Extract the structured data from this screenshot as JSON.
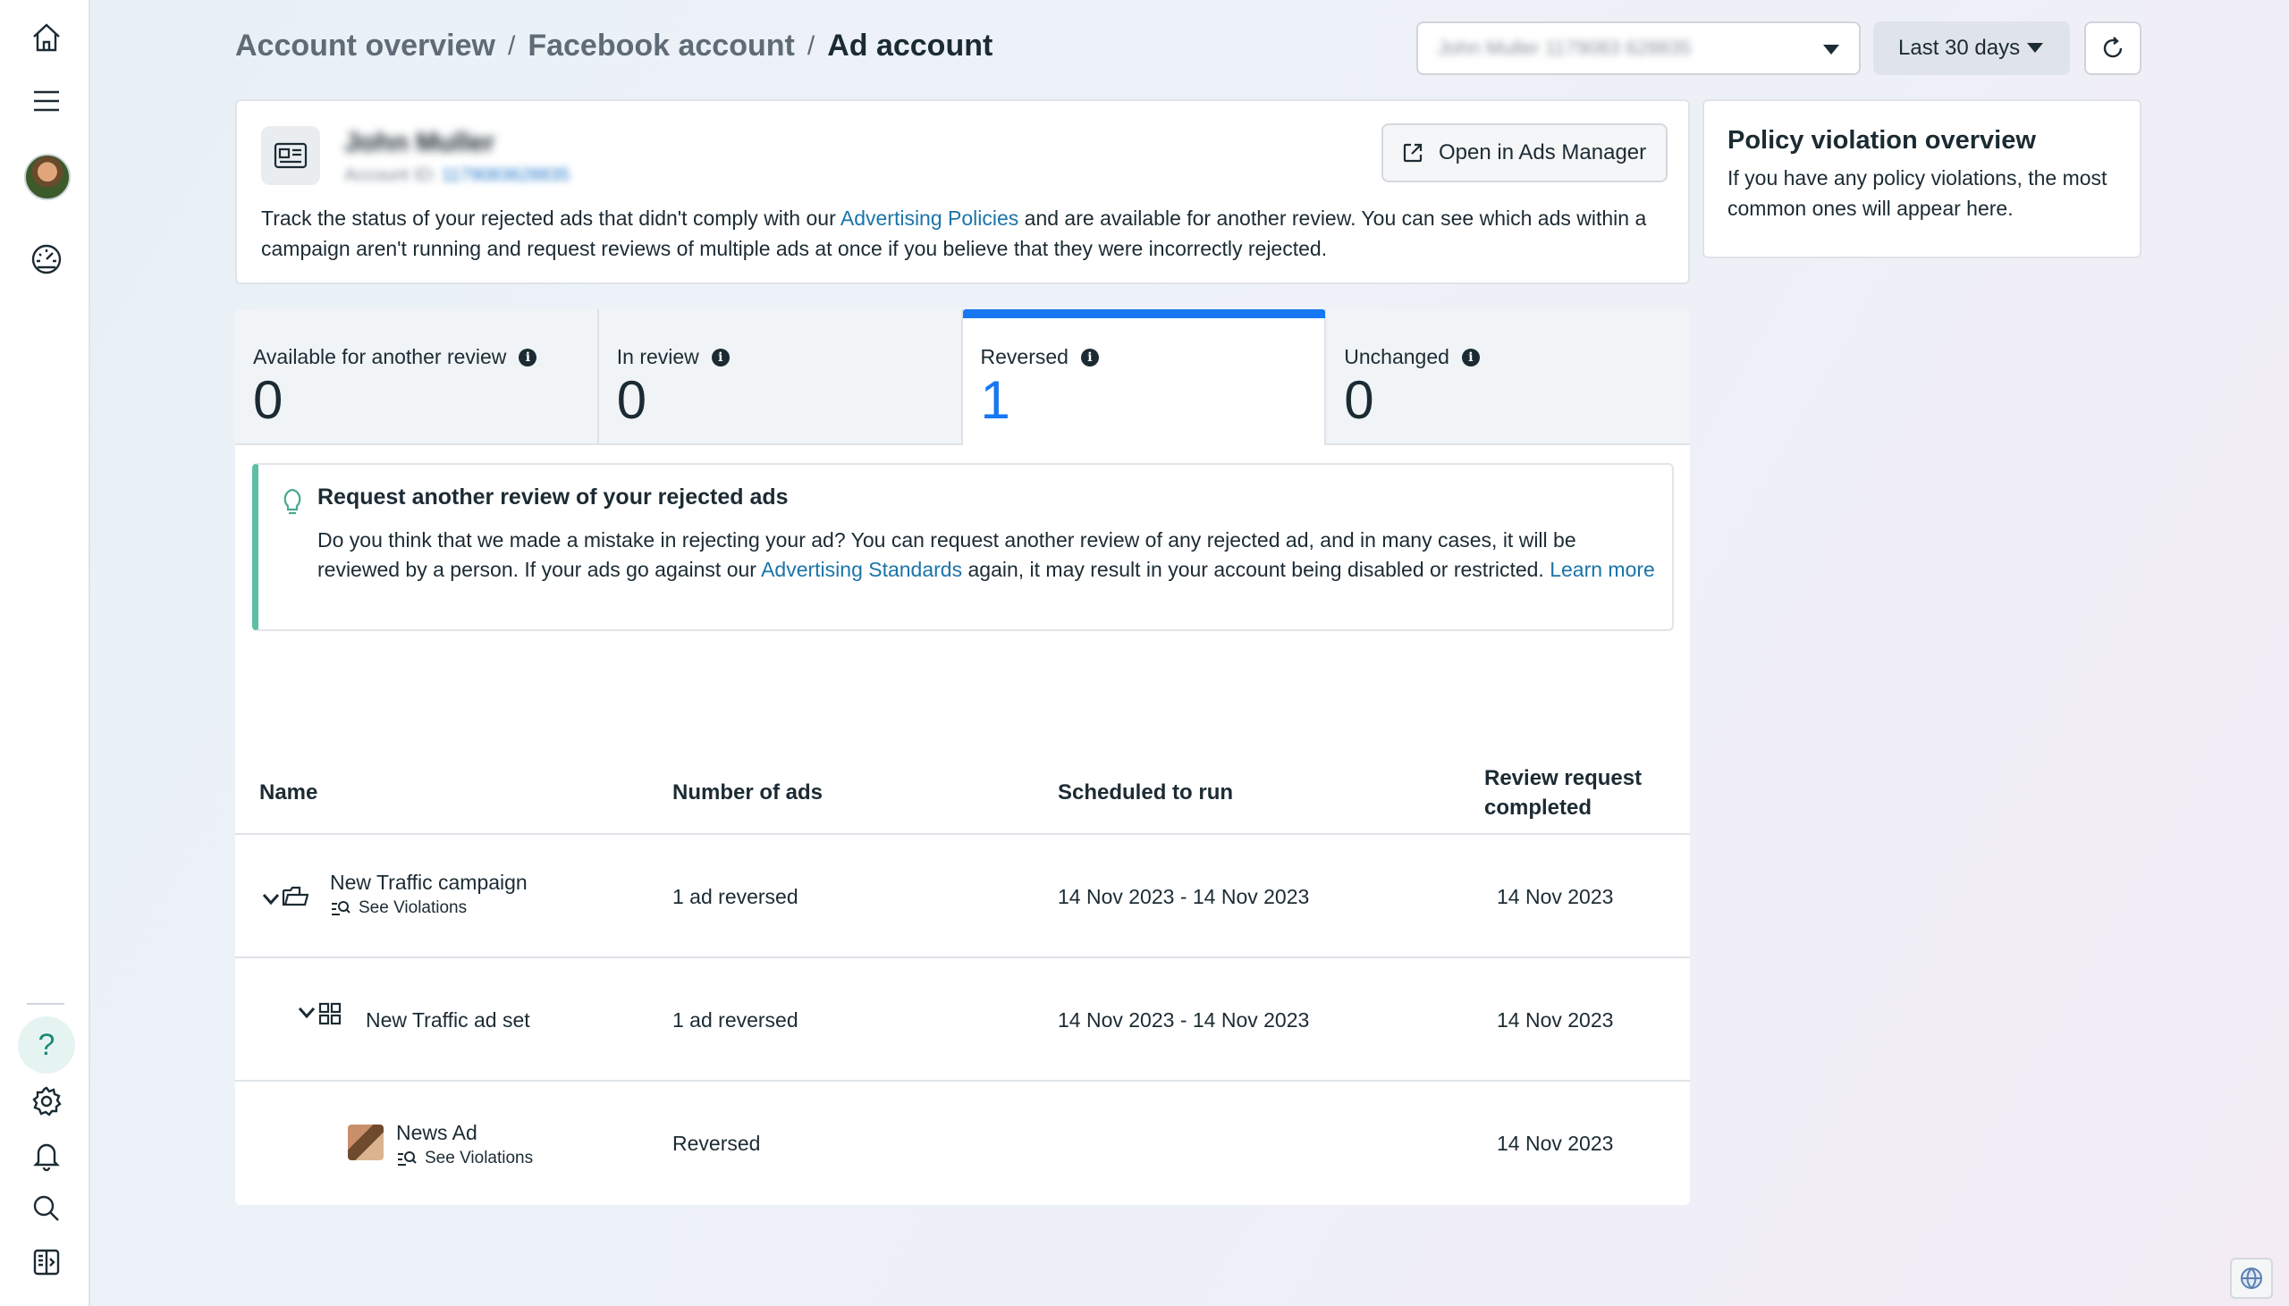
{
  "breadcrumb": {
    "items": [
      "Account overview",
      "Facebook account",
      "Ad account"
    ],
    "separator": "/"
  },
  "header": {
    "account_selector_value": "John Muller 1179083 628835",
    "date_range": "Last 30 days"
  },
  "account_card": {
    "name": "John Muller",
    "id_label": "Account ID:",
    "id_value": "1179083628835",
    "open_button": "Open in Ads Manager",
    "description_prefix": "Track the status of your rejected ads that didn't comply with our ",
    "description_link": "Advertising Policies",
    "description_suffix": " and are available for another review. You can see which ads within a campaign aren't running and request reviews of multiple ads at once if you believe that they were incorrectly rejected."
  },
  "policy_card": {
    "title": "Policy violation overview",
    "text": "If you have any policy violations, the most common ones will appear here."
  },
  "tabs": [
    {
      "label": "Available for another review",
      "count": "0",
      "selected": false
    },
    {
      "label": "In review",
      "count": "0",
      "selected": false
    },
    {
      "label": "Reversed",
      "count": "1",
      "selected": true
    },
    {
      "label": "Unchanged",
      "count": "0",
      "selected": false
    }
  ],
  "callout": {
    "title": "Request another review of your rejected ads",
    "body_prefix": "Do you think that we made a mistake in rejecting your ad? You can request another review of any rejected ad, and in many cases, it will be reviewed by a person. If your ads go against our ",
    "body_link": "Advertising Standards",
    "body_middle": " again, it may result in your account being disabled or restricted. ",
    "learn_more": "Learn more"
  },
  "table": {
    "headers": [
      "Name",
      "Number of ads",
      "Scheduled to run",
      "Review request completed"
    ],
    "rows": [
      {
        "name": "New Traffic campaign",
        "sub": "See Violations",
        "ads": "1 ad reversed",
        "scheduled": "14 Nov 2023 - 14 Nov 2023",
        "completed": "14 Nov 2023",
        "type": "campaign"
      },
      {
        "name": "New Traffic ad set",
        "sub": "",
        "ads": "1 ad reversed",
        "scheduled": "14 Nov 2023 - 14 Nov 2023",
        "completed": "14 Nov 2023",
        "type": "adset"
      },
      {
        "name": "News Ad",
        "sub": "See Violations",
        "ads": "Reversed",
        "scheduled": "",
        "completed": "14 Nov 2023",
        "type": "ad"
      }
    ]
  },
  "rail": {
    "top_icons": [
      "home-icon",
      "menu-icon",
      "avatar",
      "dashboard-icon"
    ],
    "bottom_icons": [
      "help-icon",
      "settings-icon",
      "notifications-icon",
      "search-icon",
      "collapse-panel-icon"
    ],
    "help_glyph": "?"
  },
  "colors": {
    "accent": "#1877f2",
    "link": "#1a74a8",
    "callout_border": "#5cbfa4"
  }
}
